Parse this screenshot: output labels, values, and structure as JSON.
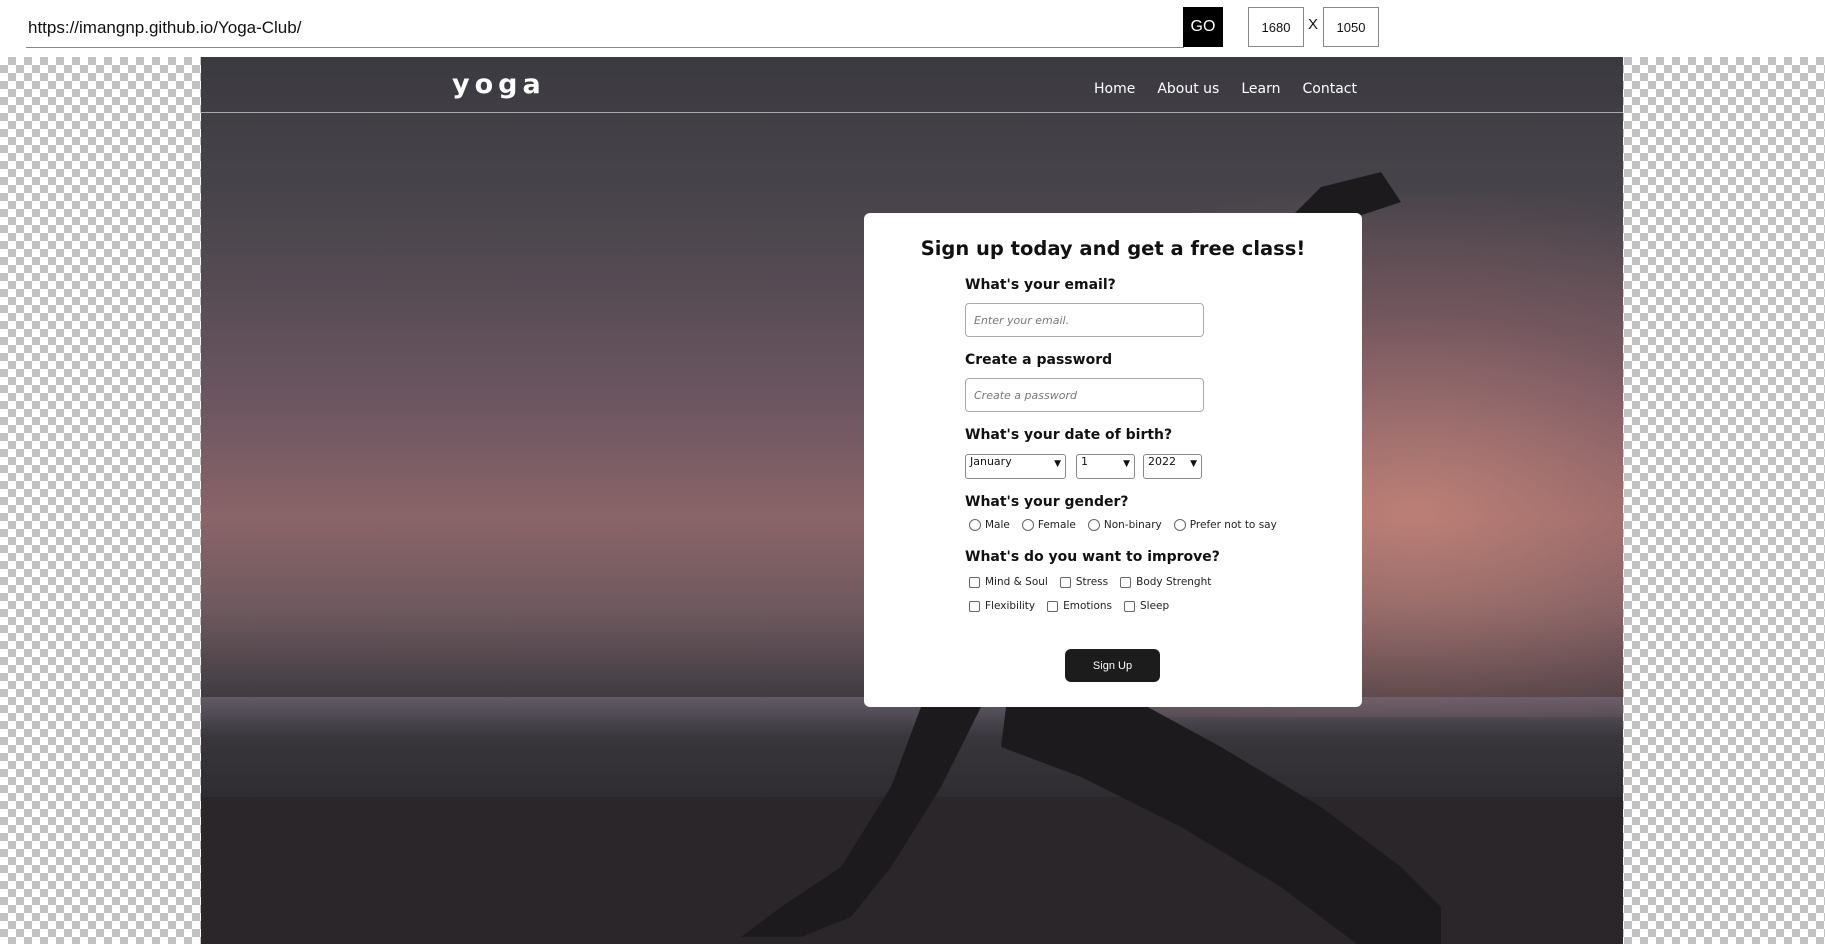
{
  "browser": {
    "url": "https://imangnp.github.io/Yoga-Club/",
    "go_label": "GO",
    "width_value": "1680",
    "height_value": "1050",
    "separator": "X"
  },
  "site": {
    "logo": "yoga",
    "nav": [
      "Home",
      "About us",
      "Learn",
      "Contact"
    ]
  },
  "form": {
    "title": "Sign up today and get a free class!",
    "email": {
      "label": "What's your email?",
      "placeholder": "Enter your email."
    },
    "password": {
      "label": "Create a password",
      "placeholder": "Create a password"
    },
    "dob": {
      "label": "What's your date of birth?",
      "month": "January",
      "day": "1",
      "year": "2022"
    },
    "gender": {
      "label": "What's your gender?",
      "options": [
        "Male",
        "Female",
        "Non-binary",
        "Prefer not to say"
      ]
    },
    "improve": {
      "label": "What's do you want to improve?",
      "row1": [
        "Mind & Soul",
        "Stress",
        "Body Strenght"
      ],
      "row2": [
        "Flexibility",
        "Emotions",
        "Sleep"
      ]
    },
    "submit_label": "Sign Up"
  }
}
